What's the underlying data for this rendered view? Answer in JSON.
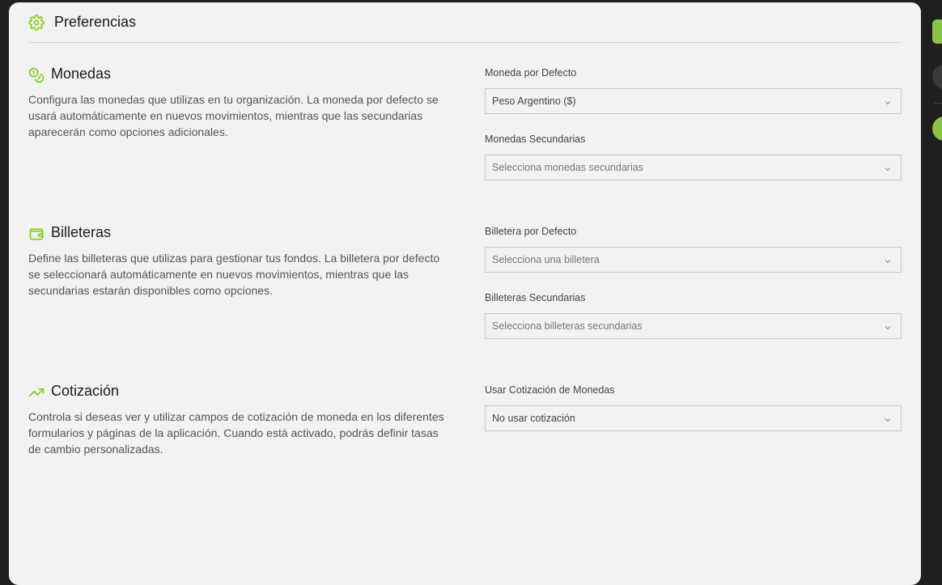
{
  "header": {
    "title": "Preferencias",
    "icon": "gear-icon"
  },
  "colors": {
    "accent": "#84cc16",
    "panel": "#f2f2f2",
    "text": "#1a1a1a"
  },
  "sections": {
    "monedas": {
      "title": "Monedas",
      "icon": "coins-icon",
      "description": "Configura las monedas que utilizas en tu organización. La moneda por defecto se usará automáticamente en nuevos movimientos, mientras que las secundarias aparecerán como opciones adicionales.",
      "fields": [
        {
          "label": "Moneda por Defecto",
          "value": "Peso Argentino ($)"
        },
        {
          "label": "Monedas Secundarias",
          "placeholder": "Selecciona monedas secundarias"
        }
      ]
    },
    "billeteras": {
      "title": "Billeteras",
      "icon": "wallet-icon",
      "description": "Define las billeteras que utilizas para gestionar tus fondos. La billetera por defecto se seleccionará automáticamente en nuevos movimientos, mientras que las secundarias estarán disponibles como opciones.",
      "fields": [
        {
          "label": "Billetera por Defecto",
          "placeholder": "Selecciona una billetera"
        },
        {
          "label": "Billeteras Secundarias",
          "placeholder": "Selecciona billeteras secundarias"
        }
      ]
    },
    "cotizacion": {
      "title": "Cotización",
      "icon": "trending-up-icon",
      "description": "Controla si deseas ver y utilizar campos de cotización de moneda en los diferentes formularios y páginas de la aplicación. Cuando está activado, podrás definir tasas de cambio personalizadas.",
      "fields": [
        {
          "label": "Usar Cotización de Monedas",
          "value": "No usar cotización"
        }
      ]
    }
  }
}
